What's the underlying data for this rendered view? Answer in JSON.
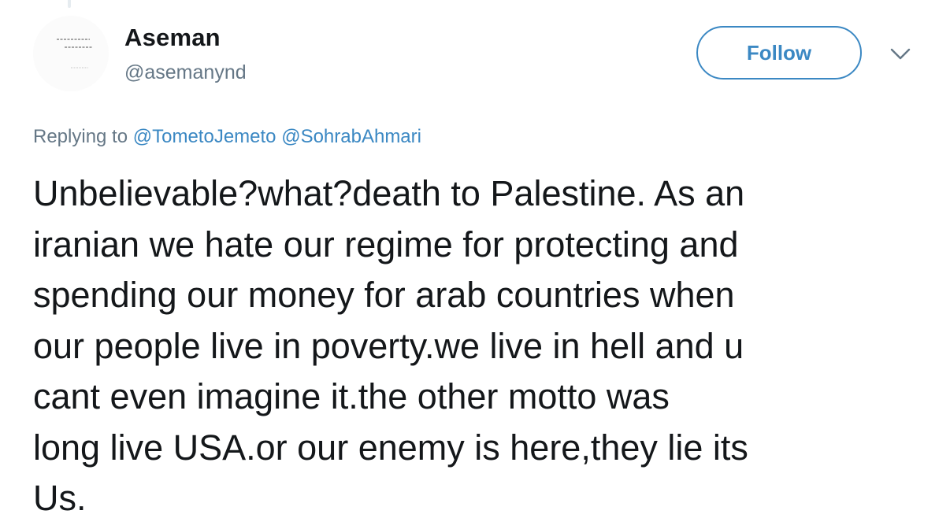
{
  "author": {
    "name": "Aseman",
    "handle": "@asemanynd"
  },
  "follow_button": {
    "label": "Follow"
  },
  "menu": {
    "icon": "chevron-down-icon"
  },
  "reply_context": {
    "prefix": "Replying to",
    "mentions": [
      "@TometoJemeto",
      "@SohrabAhmari"
    ]
  },
  "tweet": {
    "lines": [
      "Unbelievable?what?death to Palestine. As an",
      "iranian we hate our regime for protecting and",
      "spending our money for arab countries when",
      "our people live in poverty.we live in hell and u",
      "cant even imagine it.the other motto was",
      "long live USA.or our enemy is here,they lie its",
      "Us."
    ]
  },
  "colors": {
    "link": "#3b88c3",
    "secondary_text": "#657786",
    "primary_text": "#14171a"
  }
}
